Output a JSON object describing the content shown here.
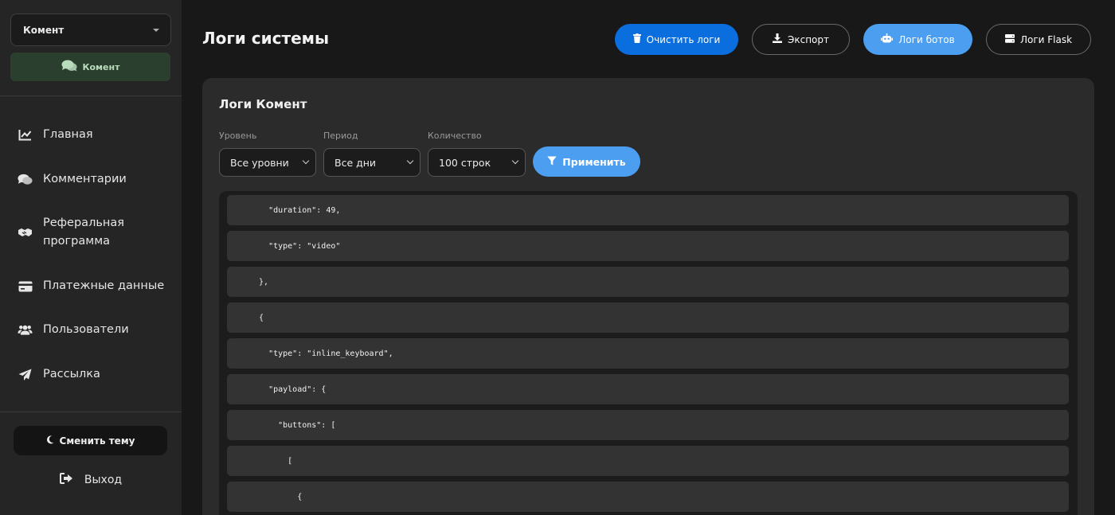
{
  "sidebar": {
    "bot_select": {
      "value": "Комент"
    },
    "bot_badge": {
      "label": "Комент"
    },
    "nav": [
      {
        "label": "Главная",
        "icon": "chart-line-icon"
      },
      {
        "label": "Комментарии",
        "icon": "comments-icon"
      },
      {
        "label": "Реферальная\nпрограмма",
        "icon": "handshake-icon"
      },
      {
        "label": "Платежные данные",
        "icon": "credit-card-icon"
      },
      {
        "label": "Пользователи",
        "icon": "users-icon"
      },
      {
        "label": "Рассылка",
        "icon": "paper-plane-icon"
      }
    ],
    "theme_button": {
      "label": "Сменить тему",
      "icon": "moon-icon"
    },
    "logout": {
      "label": "Выход",
      "icon": "sign-out-icon"
    }
  },
  "header": {
    "title": "Логи системы",
    "buttons": {
      "clear": {
        "label": "Очистить логи",
        "icon": "trash-icon"
      },
      "export": {
        "label": "Экспорт",
        "icon": "download-icon"
      },
      "bot_logs": {
        "label": "Логи ботов",
        "icon": "robot-icon"
      },
      "flask_logs": {
        "label": "Логи Flask",
        "icon": "server-icon"
      }
    }
  },
  "logs_card": {
    "title": "Логи Комент",
    "filters": {
      "level": {
        "label": "Уровень",
        "value": "Все уровни"
      },
      "period": {
        "label": "Период",
        "value": "Все дни"
      },
      "count": {
        "label": "Количество",
        "value": "100 строк"
      }
    },
    "apply_button": {
      "label": "Применить",
      "icon": "filter-icon"
    },
    "lines": [
      "    \"duration\": 49,",
      "    \"type\": \"video\"",
      "  },",
      "  {",
      "    \"type\": \"inline_keyboard\",",
      "    \"payload\": {",
      "      \"buttons\": [",
      "        [",
      "          {"
    ]
  },
  "colors": {
    "background": "#181818",
    "sidebar": "#252525",
    "card": "#2b2b2b",
    "primary_blue": "#0a6ede",
    "light_blue": "#4c9ef0",
    "active_green": "#2b3f2e"
  }
}
